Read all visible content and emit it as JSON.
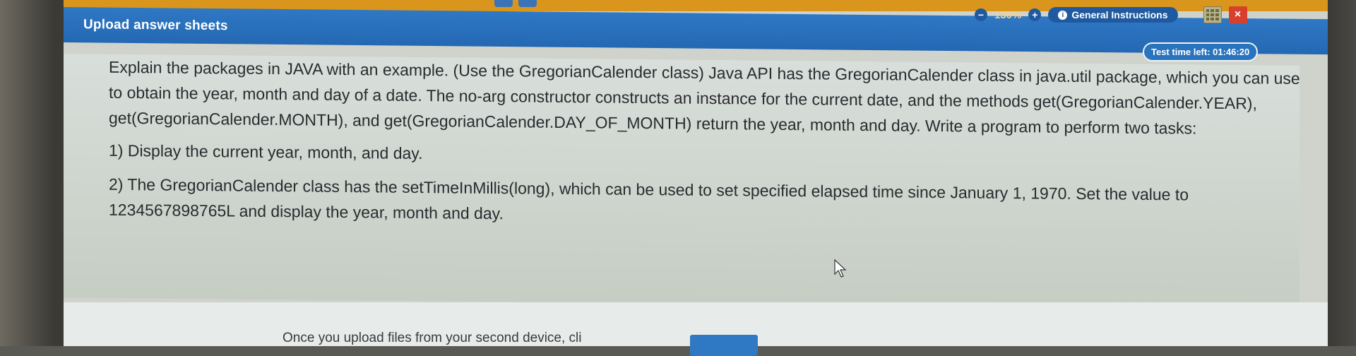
{
  "header": {
    "title": "Upload answer sheets",
    "zoom_level": "130%",
    "zoom_out_icon": "minus-icon",
    "zoom_in_icon": "plus-icon",
    "general_instructions_label": "General Instructions",
    "calculator_icon": "calculator-icon",
    "close_icon": "close-icon",
    "close_symbol": "×"
  },
  "timer": {
    "text": "Test time left: 01:46:20"
  },
  "question": {
    "intro": "Explain the packages in JAVA with an example. (Use the GregorianCalender class) Java API has the GregorianCalender class in java.util package, which you can use to obtain the year, month and day of a date. The no-arg constructor constructs an instance for the current date, and the methods get(GregorianCalender.YEAR), get(GregorianCalender.MONTH), and get(GregorianCalender.DAY_OF_MONTH) return the year, month and day. Write a program to perform two tasks:",
    "task1": "1) Display the current year, month, and day.",
    "task2": "2) The GregorianCalender class has the setTimeInMillis(long), which can be used to set specified elapsed time since January 1, 1970. Set the value to 1234567898765L and display the year, month and day."
  },
  "footer": {
    "upload_text": "Once you upload files from your second device, cli"
  },
  "colors": {
    "header_blue": "#2a6fbc",
    "top_orange": "#d9951c",
    "close_red": "#d8402c"
  }
}
